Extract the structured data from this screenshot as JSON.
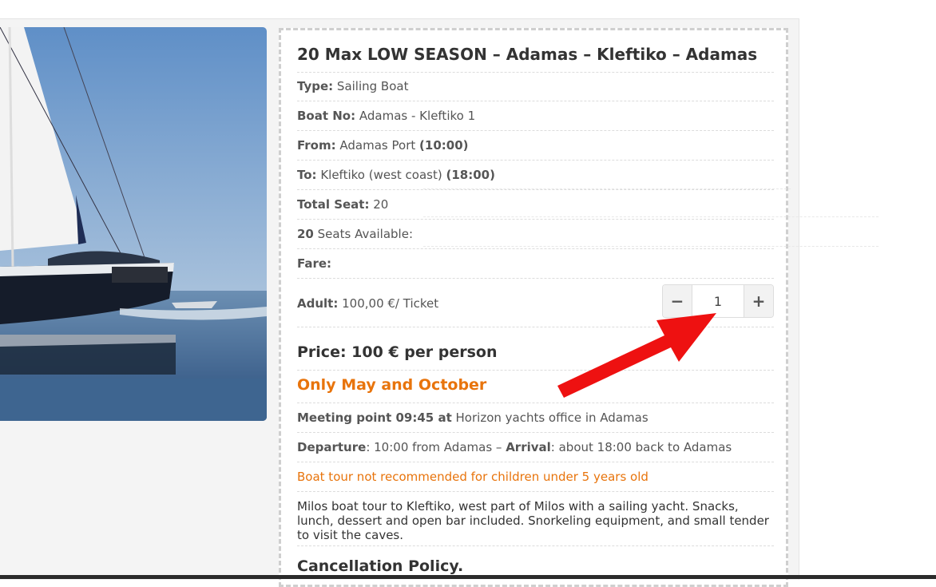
{
  "tour": {
    "title": "20 Max LOW SEASON – Adamas – Kleftiko – Adamas",
    "type_label": "Type:",
    "type_value": "Sailing Boat",
    "boat_no_label": "Boat No:",
    "boat_no_value": "Adamas - Kleftiko 1",
    "from_label": "From:",
    "from_value": "Adamas Port",
    "from_time": "(10:00)",
    "to_label": "To:",
    "to_value": "Kleftiko (west coast)",
    "to_time": "(18:00)",
    "total_seat_label": "Total Seat:",
    "total_seat_value": "20",
    "seats_available_count": "20",
    "seats_available_text": "Seats Available:",
    "fare_label": "Fare:",
    "adult_label": "Adult:",
    "adult_price": "100,00 €/ Ticket",
    "quantity": "1",
    "minus": "−",
    "plus": "+",
    "price": "Price: 100 € per person",
    "season_note": "Only May and October",
    "meeting_bold": "Meeting point 09:45 at",
    "meeting_text": "Horizon yachts office in Adamas",
    "departure_label": "Departure",
    "departure_text": ": 10:00 from Adamas –",
    "arrival_label": "Arrival",
    "arrival_text": ": about 18:00 back to Adamas",
    "children_warning": "Boat tour not recommended for children under 5 years old",
    "description": "Milos boat tour to Kleftiko, west part of Milos with a sailing yacht. Snacks, lunch, dessert and open bar included. Snorkeling equipment, and small tender to visit the caves.",
    "cancellation_heading": "Cancellation Policy."
  },
  "colors": {
    "accent_orange": "#e8740c",
    "arrow_red": "#ee1111"
  }
}
